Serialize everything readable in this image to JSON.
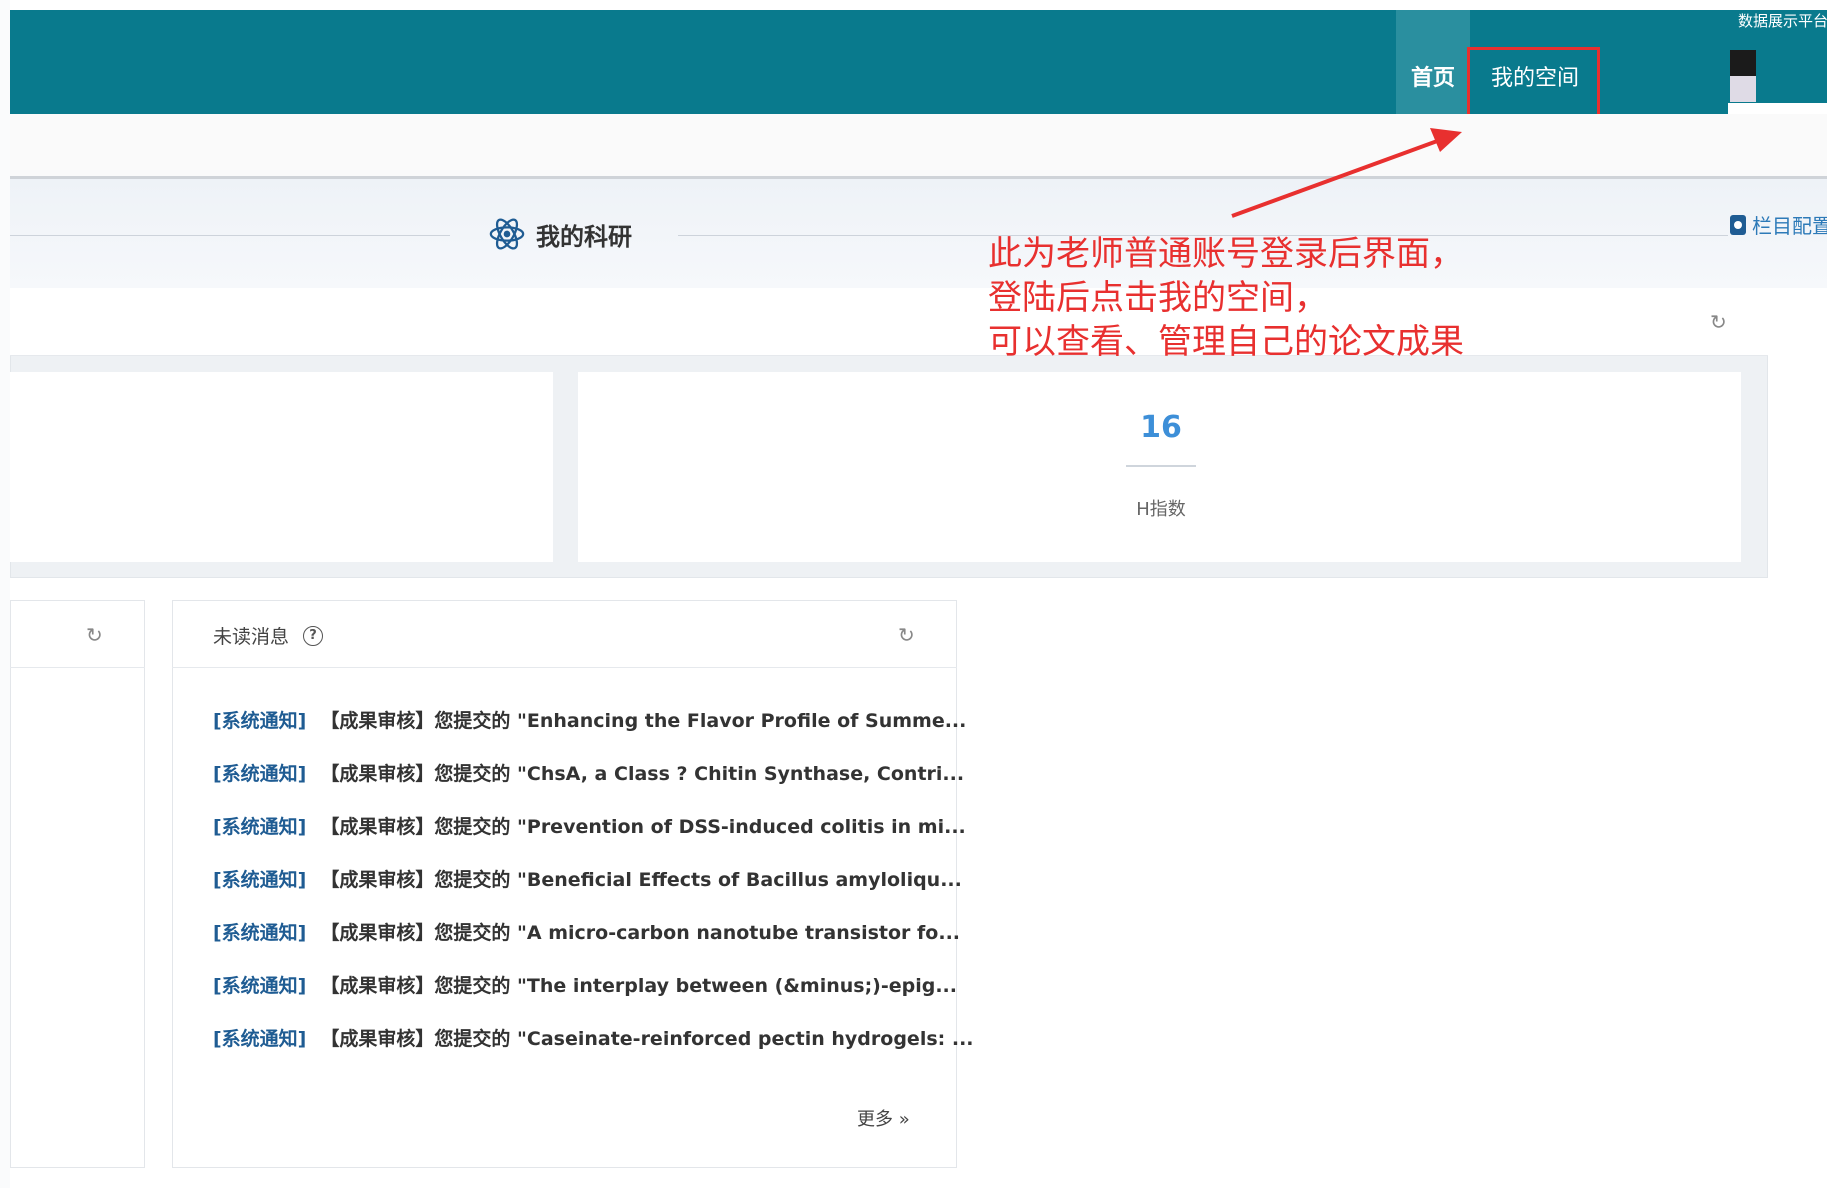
{
  "header": {
    "platform_label": "数据展示平台",
    "nav": {
      "home": "首页",
      "my_space": "我的空间"
    }
  },
  "section": {
    "title": "我的科研",
    "column_config": "栏目配置"
  },
  "research": {
    "h_index_value": "16",
    "h_index_label": "H指数"
  },
  "annotation": {
    "line1": "此为老师普通账号登录后界面，",
    "line2": "登陆后点击我的空间，",
    "line3": "可以查看、管理自己的论文成果"
  },
  "messages": {
    "title": "未读消息",
    "items": [
      {
        "tag": "[系统通知]",
        "text": "【成果审核】您提交的 \"Enhancing the Flavor Profile of Summe..."
      },
      {
        "tag": "[系统通知]",
        "text": "【成果审核】您提交的 \"ChsA, a Class ? Chitin Synthase, Contri..."
      },
      {
        "tag": "[系统通知]",
        "text": "【成果审核】您提交的 \"Prevention of DSS-induced colitis in mi..."
      },
      {
        "tag": "[系统通知]",
        "text": "【成果审核】您提交的 \"Beneficial Effects of Bacillus amyloliqu..."
      },
      {
        "tag": "[系统通知]",
        "text": "【成果审核】您提交的 \"A micro-carbon nanotube transistor fo..."
      },
      {
        "tag": "[系统通知]",
        "text": "【成果审核】您提交的 \"The interplay between (&minus;)-epig..."
      },
      {
        "tag": "[系统通知]",
        "text": "【成果审核】您提交的 \"Caseinate-reinforced pectin hydrogels: ..."
      }
    ],
    "more": "更多 »"
  },
  "colors": {
    "header_bg": "#097a8d",
    "annotation_red": "#e8302f",
    "tag_blue": "#1f5c93",
    "h_index_blue": "#3d8fd8"
  }
}
